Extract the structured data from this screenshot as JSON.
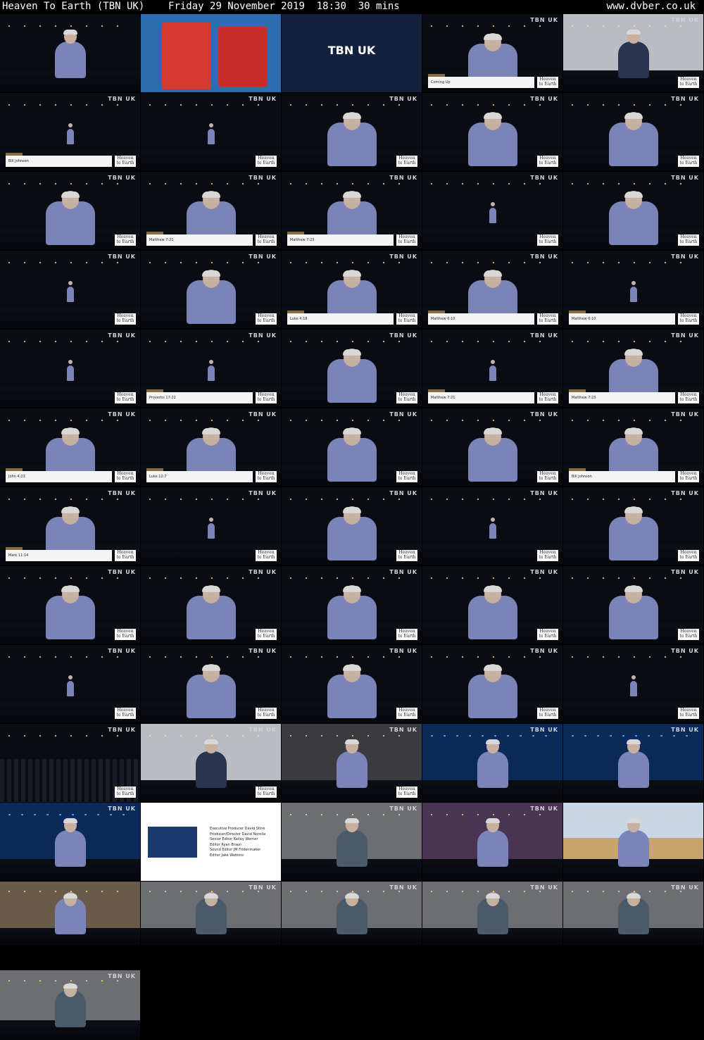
{
  "header": {
    "title": "Heaven To Earth (TBN UK)",
    "broadcast": "Friday 29 November 2019  18:30  30 mins",
    "site": "www.dvber.co.uk"
  },
  "colors": {
    "background": "#000000",
    "text": "#ffffff",
    "lower_third_accent": "#8a6a3a"
  },
  "overlay": {
    "channel_logo": "TBN UK",
    "brand": "Heaven to Earth"
  },
  "thumbnails": [
    {
      "kind": "vlog"
    },
    {
      "kind": "christmas"
    },
    {
      "kind": "tbnblue"
    },
    {
      "kind": "wide",
      "caption": "Coming Up"
    },
    {
      "kind": "bright"
    },
    {
      "kind": "far",
      "caption": "Bill Johnson"
    },
    {
      "kind": "far"
    },
    {
      "kind": "wide"
    },
    {
      "kind": "wide"
    },
    {
      "kind": "wide"
    },
    {
      "kind": "wide"
    },
    {
      "kind": "wide",
      "caption": "Matthew 7:21"
    },
    {
      "kind": "wide",
      "caption": "Matthew 7:23"
    },
    {
      "kind": "far"
    },
    {
      "kind": "wide"
    },
    {
      "kind": "far"
    },
    {
      "kind": "wide"
    },
    {
      "kind": "wide",
      "caption": "Luke 4:18"
    },
    {
      "kind": "wide",
      "caption": "Matthew 6:10"
    },
    {
      "kind": "far",
      "caption": "Matthew 6:10"
    },
    {
      "kind": "far"
    },
    {
      "kind": "far",
      "caption": "Proverbs 17:22"
    },
    {
      "kind": "wide"
    },
    {
      "kind": "far",
      "caption": "Matthew 7:21"
    },
    {
      "kind": "wide",
      "caption": "Matthew 7:23"
    },
    {
      "kind": "wide",
      "caption": "John 4:23"
    },
    {
      "kind": "wide",
      "caption": "Luke 12:7"
    },
    {
      "kind": "wide"
    },
    {
      "kind": "wide"
    },
    {
      "kind": "wide",
      "caption": "Bill Johnson"
    },
    {
      "kind": "wide",
      "caption": "Mark 11:14"
    },
    {
      "kind": "far"
    },
    {
      "kind": "wide"
    },
    {
      "kind": "far"
    },
    {
      "kind": "wide"
    },
    {
      "kind": "wide"
    },
    {
      "kind": "wide"
    },
    {
      "kind": "wide"
    },
    {
      "kind": "wide"
    },
    {
      "kind": "wide"
    },
    {
      "kind": "far"
    },
    {
      "kind": "wide"
    },
    {
      "kind": "wide"
    },
    {
      "kind": "wide"
    },
    {
      "kind": "far"
    },
    {
      "kind": "crowd"
    },
    {
      "kind": "bright"
    },
    {
      "kind": "warm"
    },
    {
      "kind": "blue"
    },
    {
      "kind": "blue"
    },
    {
      "kind": "blue"
    },
    {
      "kind": "credits"
    },
    {
      "kind": "gray"
    },
    {
      "kind": "purple"
    },
    {
      "kind": "desert"
    },
    {
      "kind": "kids"
    },
    {
      "kind": "gray"
    },
    {
      "kind": "gray"
    },
    {
      "kind": "gray"
    },
    {
      "kind": "gray"
    },
    {
      "kind": "gray"
    }
  ],
  "credits": [
    "Executive Producer   David Stine",
    "Producer/Director   David Norolla",
    "Senior Editor   Kelley Werner",
    "Editor   Ryan Braun",
    "Sound Editor   JM Fridenmaker",
    "Editor   Jake Watkins"
  ]
}
